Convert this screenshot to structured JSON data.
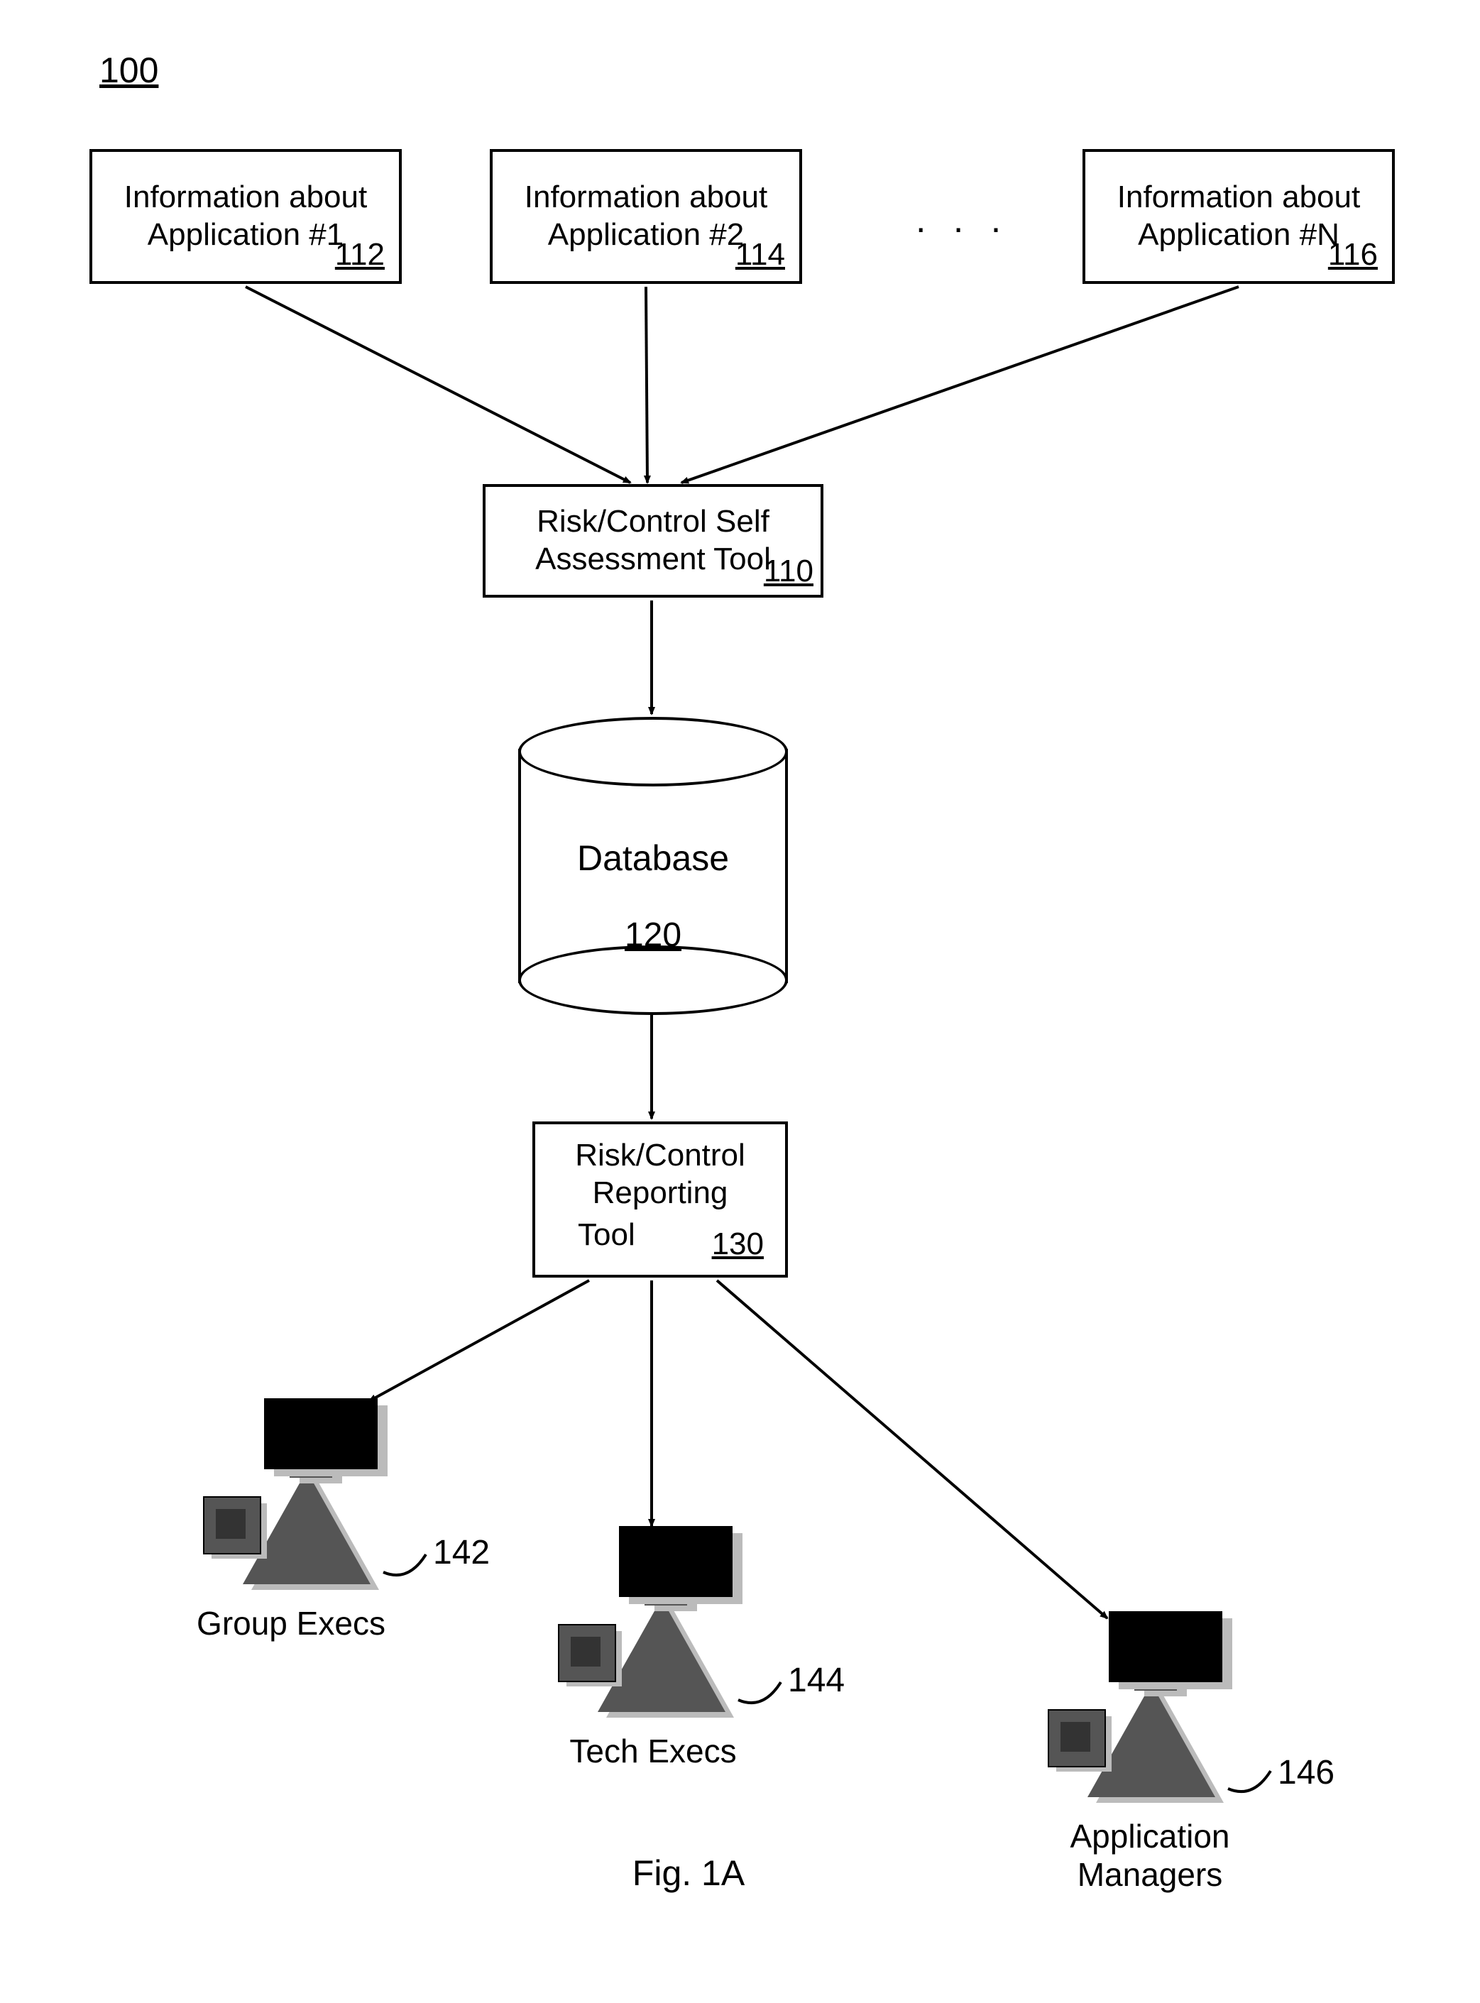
{
  "figure_ref": "100",
  "inputs": [
    {
      "line1": "Information about",
      "line2": "Application #1",
      "ref": "112"
    },
    {
      "line1": "Information about",
      "line2": "Application #2",
      "ref": "114"
    },
    {
      "line1": "Information about",
      "line2": "Application #N",
      "ref": "116"
    }
  ],
  "ellipsis": ". . .",
  "assessment": {
    "line1": "Risk/Control Self",
    "line2": "Assessment Tool",
    "ref": "110"
  },
  "database": {
    "label": "Database",
    "ref": "120"
  },
  "reporting": {
    "line1": "Risk/Control",
    "line2": "Reporting",
    "line3": "Tool",
    "ref": "130"
  },
  "users": [
    {
      "label": "Group Execs",
      "ref": "142"
    },
    {
      "label": "Tech Execs",
      "ref": "144"
    },
    {
      "label_line1": "Application",
      "label_line2": "Managers",
      "ref": "146"
    }
  ],
  "figure_caption": "Fig. 1A"
}
